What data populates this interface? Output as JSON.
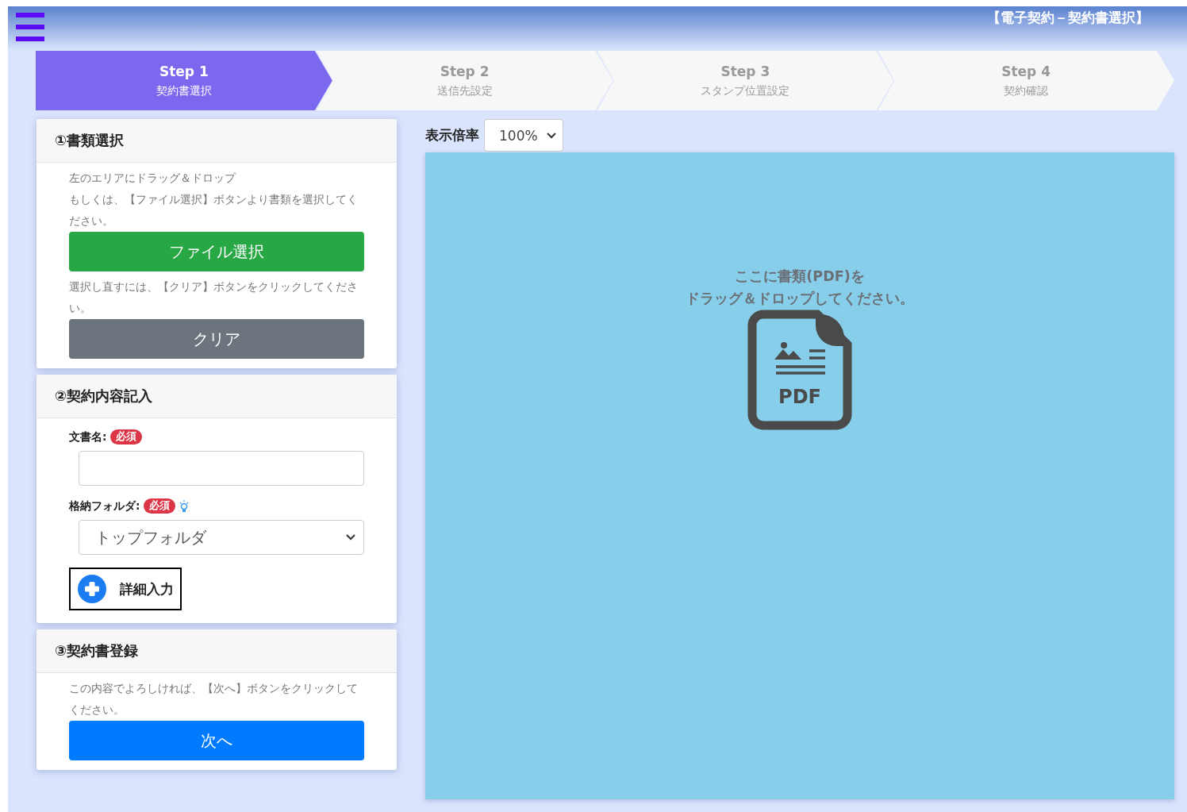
{
  "header": {
    "title": "【電子契約－契約書選択】"
  },
  "steps": [
    {
      "title": "Step 1",
      "subtitle": "契約書選択",
      "selected": true
    },
    {
      "title": "Step 2",
      "subtitle": "送信先設定",
      "selected": false
    },
    {
      "title": "Step 3",
      "subtitle": "スタンプ位置設定",
      "selected": false
    },
    {
      "title": "Step 4",
      "subtitle": "契約確認",
      "selected": false
    }
  ],
  "sections": [
    {
      "title": "①書類選択",
      "items": [
        {
          "kind": "text",
          "text": "左のエリアにドラッグ＆ドロップ"
        },
        {
          "kind": "text",
          "text": "もしくは、【ファイル選択】ボタンより書類を選択してください。"
        },
        {
          "kind": "button",
          "label": "ファイル選択",
          "color": "#28a745"
        },
        {
          "kind": "text",
          "text": "選択し直すには、【クリア】ボタンをクリックしてください。"
        },
        {
          "kind": "button",
          "label": "クリア",
          "color": "#6c757d"
        }
      ]
    },
    {
      "title": "②契約内容記入",
      "items": [
        {
          "kind": "input",
          "label": "文書名:",
          "badge": "必須",
          "help": false
        },
        {
          "kind": "select",
          "label": "格納フォルダ:",
          "badge": "必須",
          "help": true,
          "value": "トップフォルダ"
        },
        {
          "kind": "toggle",
          "label": "詳細入力"
        }
      ]
    },
    {
      "title": "③契約書登録",
      "items": [
        {
          "kind": "text",
          "text": "この内容でよろしければ、【次へ】ボタンをクリックしてください。"
        },
        {
          "kind": "button",
          "label": "次へ",
          "color": "#007bff"
        }
      ]
    }
  ],
  "zoom": {
    "label": "表示倍率",
    "value": "100%"
  },
  "dropzone": {
    "lines": [
      "ここに書類(PDF)を",
      "ドラッグ＆ドロップしてください。"
    ],
    "icon_label": "PDF"
  }
}
